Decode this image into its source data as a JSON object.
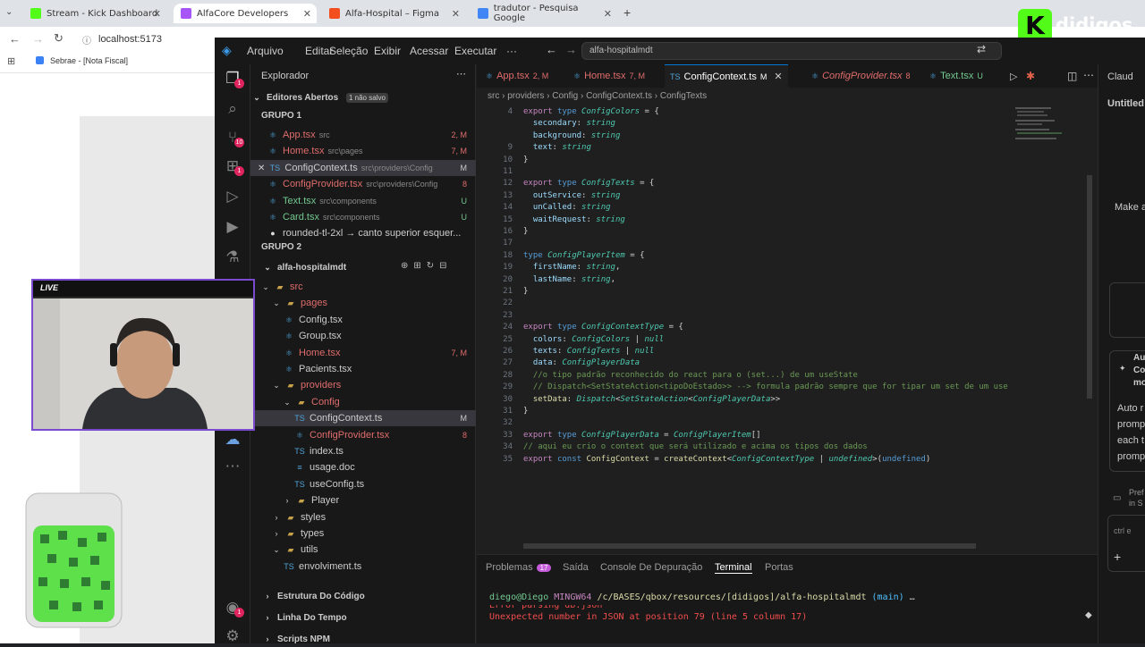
{
  "browser": {
    "tabs": [
      {
        "label": "Stream - Kick Dashboard",
        "color": "#53fc18"
      },
      {
        "label": "AlfaCore Developers",
        "color": "#a855f7"
      },
      {
        "label": "Alfa-Hospital – Figma",
        "color": "#f24e1e"
      },
      {
        "label": "tradutor - Pesquisa Google",
        "color": "#4285f4"
      }
    ],
    "url": "localhost:5173",
    "bookmark": "Sebrae - [Nota Fiscal]"
  },
  "vscode": {
    "menu": [
      "Arquivo",
      "Editar",
      "Seleção",
      "Exibir",
      "Acessar",
      "Executar",
      "···"
    ],
    "search": "alfa-hospitalmdt",
    "activity_badges": [
      "1",
      "10",
      "1",
      "1"
    ],
    "explorer": {
      "title": "Explorador",
      "open_editors_label": "Editores Abertos",
      "unsaved_badge": "1 não salvo",
      "group1": "GRUPO 1",
      "group2": "GRUPO 2",
      "open_files": [
        {
          "name": "App.tsx",
          "path": "src",
          "status": "2, M",
          "color": "#e06c6c"
        },
        {
          "name": "Home.tsx",
          "path": "src\\pages",
          "status": "7, M",
          "color": "#e06c6c"
        },
        {
          "name": "ConfigContext.ts",
          "path": "src\\providers\\Config",
          "status": "M",
          "color": "#cccccc"
        },
        {
          "name": "ConfigProvider.tsx",
          "path": "src\\providers\\Config",
          "status": "8",
          "color": "#e06c6c"
        },
        {
          "name": "Text.tsx",
          "path": "src\\components",
          "status": "U",
          "color": "#73c991"
        },
        {
          "name": "Card.tsx",
          "path": "src\\components",
          "status": "U",
          "color": "#73c991"
        },
        {
          "name": "rounded-tl-2xl → canto superior esquer...",
          "path": "",
          "status": "",
          "color": "#cccccc"
        }
      ],
      "project": "alfa-hospitalmdt",
      "tree": [
        {
          "label": "src",
          "indent": 1,
          "kind": "folder-open",
          "color": "#e06c6c"
        },
        {
          "label": "pages",
          "indent": 2,
          "kind": "folder-open",
          "color": "#e06c6c"
        },
        {
          "label": "Config.tsx",
          "indent": 3,
          "kind": "file",
          "color": "#cccccc"
        },
        {
          "label": "Group.tsx",
          "indent": 3,
          "kind": "file",
          "color": "#cccccc"
        },
        {
          "label": "Home.tsx",
          "indent": 3,
          "kind": "file",
          "color": "#e06c6c",
          "status": "7, M"
        },
        {
          "label": "Pacients.tsx",
          "indent": 3,
          "kind": "file",
          "color": "#cccccc"
        },
        {
          "label": "providers",
          "indent": 2,
          "kind": "folder-open",
          "color": "#e06c6c"
        },
        {
          "label": "Config",
          "indent": 3,
          "kind": "folder-open",
          "color": "#e06c6c"
        },
        {
          "label": "ConfigContext.ts",
          "indent": 4,
          "kind": "file",
          "color": "#cccccc",
          "status": "M"
        },
        {
          "label": "ConfigProvider.tsx",
          "indent": 4,
          "kind": "file",
          "color": "#e06c6c",
          "status": "8"
        },
        {
          "label": "index.ts",
          "indent": 4,
          "kind": "file",
          "color": "#cccccc"
        },
        {
          "label": "usage.doc",
          "indent": 4,
          "kind": "file",
          "color": "#cccccc"
        },
        {
          "label": "useConfig.ts",
          "indent": 4,
          "kind": "file",
          "color": "#cccccc"
        },
        {
          "label": "Player",
          "indent": 3,
          "kind": "folder",
          "color": "#cccccc"
        },
        {
          "label": "styles",
          "indent": 2,
          "kind": "folder",
          "color": "#cccccc"
        },
        {
          "label": "types",
          "indent": 2,
          "kind": "folder",
          "color": "#cccccc"
        },
        {
          "label": "utils",
          "indent": 2,
          "kind": "folder-open",
          "color": "#cccccc"
        },
        {
          "label": "envolviment.ts",
          "indent": 3,
          "kind": "file",
          "color": "#cccccc"
        }
      ],
      "sections": [
        "Estrutura Do Código",
        "Linha Do Tempo",
        "Scripts NPM"
      ]
    },
    "editor_tabs": [
      {
        "label": "App.tsx",
        "mark": "2, M",
        "color": "#e06c6c"
      },
      {
        "label": "Home.tsx",
        "mark": "7, M",
        "color": "#e06c6c"
      },
      {
        "label": "ConfigContext.ts",
        "mark": "M",
        "color": "#ffffff"
      },
      {
        "label": "ConfigProvider.tsx",
        "mark": "8",
        "color": "#e06c6c"
      },
      {
        "label": "Text.tsx",
        "mark": "U",
        "color": "#73c991"
      }
    ],
    "breadcrumb": [
      "src",
      "providers",
      "Config",
      "ConfigContext.ts",
      "ConfigTexts"
    ],
    "code": [
      {
        "n": "4",
        "html": "<span class='kw'>export</span> <span class='kb'>type</span> <span class='ty'>ConfigColors</span> = {"
      },
      {
        "n": "",
        "html": "  <span class='pr'>secondary</span>: <span class='ty'>string</span>"
      },
      {
        "n": "",
        "html": "  <span class='pr'>background</span>: <span class='ty'>string</span>"
      },
      {
        "n": "9",
        "html": "  <span class='pr'>text</span>: <span class='ty'>string</span>"
      },
      {
        "n": "10",
        "html": "}"
      },
      {
        "n": "11",
        "html": ""
      },
      {
        "n": "12",
        "html": "<span class='kw'>export</span> <span class='kb'>type</span> <span class='ty'>ConfigTexts</span> = {"
      },
      {
        "n": "13",
        "html": "  <span class='pr'>outService</span>: <span class='ty'>string</span>"
      },
      {
        "n": "14",
        "html": "  <span class='pr'>unCalled</span>: <span class='ty'>string</span>"
      },
      {
        "n": "15",
        "html": "  <span class='pr'>waitRequest</span>: <span class='ty'>string</span>"
      },
      {
        "n": "16",
        "html": "}"
      },
      {
        "n": "17",
        "html": ""
      },
      {
        "n": "18",
        "html": "<span class='kb'>type</span> <span class='ty'>ConfigPlayerItem</span> = {"
      },
      {
        "n": "19",
        "html": "  <span class='pr'>firstName</span>: <span class='ty'>string</span>,"
      },
      {
        "n": "20",
        "html": "  <span class='pr'>lastName</span>: <span class='ty'>string</span>,"
      },
      {
        "n": "21",
        "html": "}"
      },
      {
        "n": "22",
        "html": ""
      },
      {
        "n": "23",
        "html": ""
      },
      {
        "n": "24",
        "html": "<span class='kw'>export</span> <span class='kb'>type</span> <span class='ty'>ConfigContextType</span> = {"
      },
      {
        "n": "25",
        "html": "  <span class='pr'>colors</span>: <span class='ty'>ConfigColors</span> | <span class='ty'>null</span>"
      },
      {
        "n": "26",
        "html": "  <span class='pr'>texts</span>: <span class='ty'>ConfigTexts</span> | <span class='ty'>null</span>"
      },
      {
        "n": "27",
        "html": "  <span class='pr'>data</span>: <span class='ty'>ConfigPlayerData</span>"
      },
      {
        "n": "28",
        "html": "  <span class='cm'>//o tipo padrão reconhecido do react para o (set...) de um useState</span>"
      },
      {
        "n": "29",
        "html": "  <span class='cm'>// Dispatch&lt;SetStateAction&lt;tipoDoEstado&gt;&gt; --&gt; formula padrão sempre que for tipar um set de um use</span>"
      },
      {
        "n": "30",
        "html": "  <span class='fn'>setData</span>: <span class='ty'>Dispatch</span>&lt;<span class='ty'>SetStateAction</span>&lt;<span class='ty'>ConfigPlayerData</span>&gt;&gt;"
      },
      {
        "n": "31",
        "html": "}"
      },
      {
        "n": "32",
        "html": ""
      },
      {
        "n": "33",
        "html": "<span class='kw'>export</span> <span class='kb'>type</span> <span class='ty'>ConfigPlayerData</span> = <span class='ty'>ConfigPlayerItem</span>[]"
      },
      {
        "n": "34",
        "html": "<span class='cm'>// aqui eu crio o context que será utilizado e acima os tipos dos dados</span>"
      },
      {
        "n": "35",
        "html": "<span class='kw'>export</span> <span class='kb'>const</span> <span class='fn'>ConfigContext</span> = <span class='fn'>createContext</span>&lt;<span class='ty'>ConfigContextType</span> | <span class='ty'>undefined</span>&gt;(<span class='kb'>undefined</span>)"
      }
    ],
    "panel": {
      "tabs": [
        "Problemas",
        "Saída",
        "Console De Depuração",
        "Terminal",
        "Portas"
      ],
      "problems_count": "17",
      "prompt_user": "diego@Diego",
      "prompt_env": "MINGW64",
      "prompt_path": "/c/BASES/qbox/resources/[didigos]/alfa-hospitalmdt",
      "prompt_branch": "(main)",
      "prompt_tail": "…",
      "line_partial": "Error parsing db.json",
      "error": "Unexpected number in JSON at position 79 (line 5 column 17)"
    },
    "chat": {
      "title": "Claud",
      "untitled": "Untitled",
      "make": "Make a",
      "au": "Au",
      "co": "Co",
      "mo": "mo",
      "auto": "Auto r",
      "promp1": "promp",
      "each": "each t",
      "promp2": "promp",
      "pref": "Pref",
      "in_s": "in S",
      "ctrl": "ctrl e"
    }
  },
  "overlay": {
    "webcam_label": "LIVE",
    "logo_text": "didigos",
    "logo_letter": "K"
  },
  "colors": {
    "accent": "#53fc18",
    "vscode_bg": "#1f1f1f",
    "error": "#f14c4c"
  }
}
